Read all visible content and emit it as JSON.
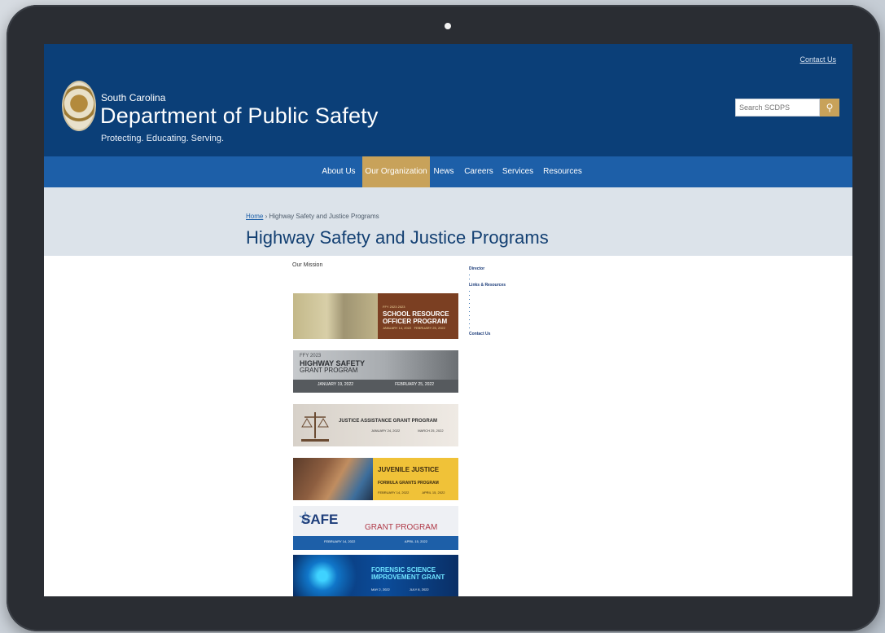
{
  "device": {
    "camera": "camera-dot"
  },
  "site": {
    "contact_link": "Contact Us",
    "brand_small": "South Carolina",
    "brand_title": "Department of Public Safety",
    "tagline": "Protecting. Educating. Serving.",
    "search": {
      "placeholder": "Search SCDPS",
      "button_icon": "search-icon"
    }
  },
  "nav": {
    "items": [
      {
        "label": "About Us",
        "active": false
      },
      {
        "label": "Our Organization",
        "active": true
      },
      {
        "label": "News",
        "active": false
      },
      {
        "label": "Careers",
        "active": false
      },
      {
        "label": "Services",
        "active": false
      },
      {
        "label": "Resources",
        "active": false
      }
    ]
  },
  "page": {
    "breadcrumb": {
      "home": "Home",
      "separator": "›",
      "current": "Highway Safety and Justice Programs"
    },
    "title": "Highway Safety and Justice Programs"
  },
  "mission": {
    "title": "Our Mission"
  },
  "banners": {
    "sro": {
      "kicker": "FFY 2023 2023",
      "title_line1": "SCHOOL RESOURCE",
      "title_line2": "OFFICER PROGRAM",
      "date1": "JANUARY 14, 2022",
      "date2": "FEBRUARY 25, 2022"
    },
    "hs": {
      "kicker": "FFY 2023",
      "title_line1": "HIGHWAY SAFETY",
      "title_line2": "GRANT PROGRAM",
      "date1": "JANUARY 19, 2022",
      "date2": "FEBRUARY 25, 2022"
    },
    "ja": {
      "title": "JUSTICE ASSISTANCE GRANT PROGRAM",
      "date1": "JANUARY 24, 2022",
      "date2": "MARCH 25, 2022"
    },
    "jj": {
      "title_line1": "JUVENILE JUSTICE",
      "title_line2": "FORMULA GRANTS PROGRAM",
      "date1": "FEBRUARY 14, 2022",
      "date2": "APRIL 15, 2022"
    },
    "psn": {
      "logo_word": "SAFE",
      "title": "GRANT PROGRAM",
      "date1": "FEBRUARY 14, 2022",
      "date2": "APRIL 15, 2022"
    },
    "fs": {
      "title_line1": "FORENSIC SCIENCE",
      "title_line2": "IMPROVEMENT GRANT",
      "date1": "MAY 2, 2022",
      "date2": "JULY 8, 2022"
    }
  },
  "sidebar": {
    "director_heading": "Director",
    "links_heading": "Links & Resources",
    "contact_heading": "Contact Us"
  }
}
